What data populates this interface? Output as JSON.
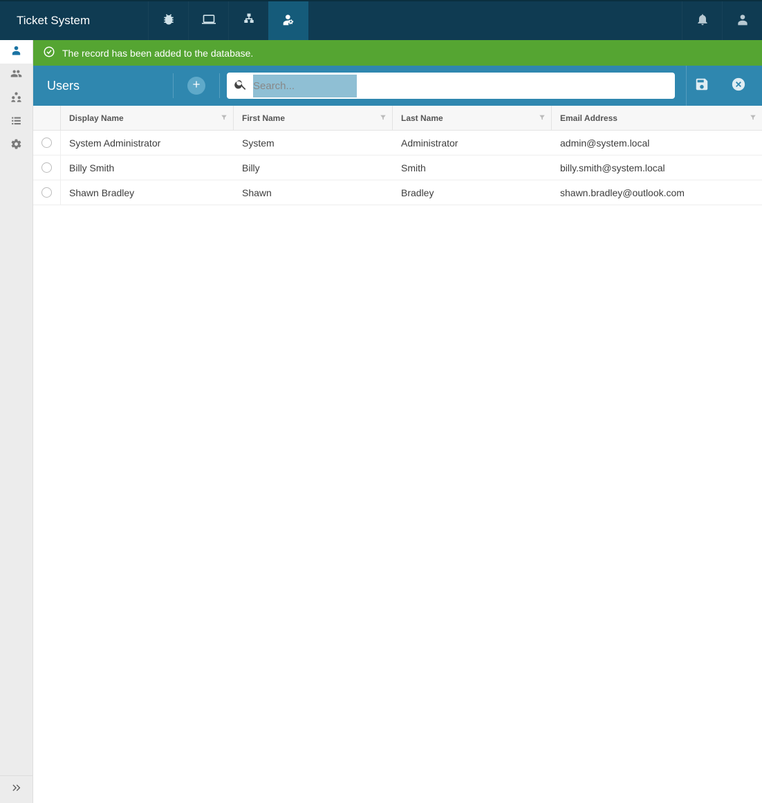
{
  "app": {
    "title": "Ticket System"
  },
  "topnav": {
    "items": [
      {
        "name": "bug",
        "active": false
      },
      {
        "name": "laptop",
        "active": false
      },
      {
        "name": "sitemap",
        "active": false
      },
      {
        "name": "user-settings",
        "active": true
      }
    ]
  },
  "notification": {
    "message": "The record has been added to the database."
  },
  "page": {
    "title": "Users"
  },
  "search": {
    "placeholder": "Search...",
    "value": ""
  },
  "columns": {
    "display_name": "Display Name",
    "first_name": "First Name",
    "last_name": "Last Name",
    "email": "Email Address"
  },
  "rows": [
    {
      "display_name": "System Administrator",
      "first_name": "System",
      "last_name": "Administrator",
      "email": "admin@system.local"
    },
    {
      "display_name": "Billy Smith",
      "first_name": "Billy",
      "last_name": "Smith",
      "email": "billy.smith@system.local"
    },
    {
      "display_name": "Shawn Bradley",
      "first_name": "Shawn",
      "last_name": "Bradley",
      "email": "shawn.bradley@outlook.com"
    }
  ]
}
